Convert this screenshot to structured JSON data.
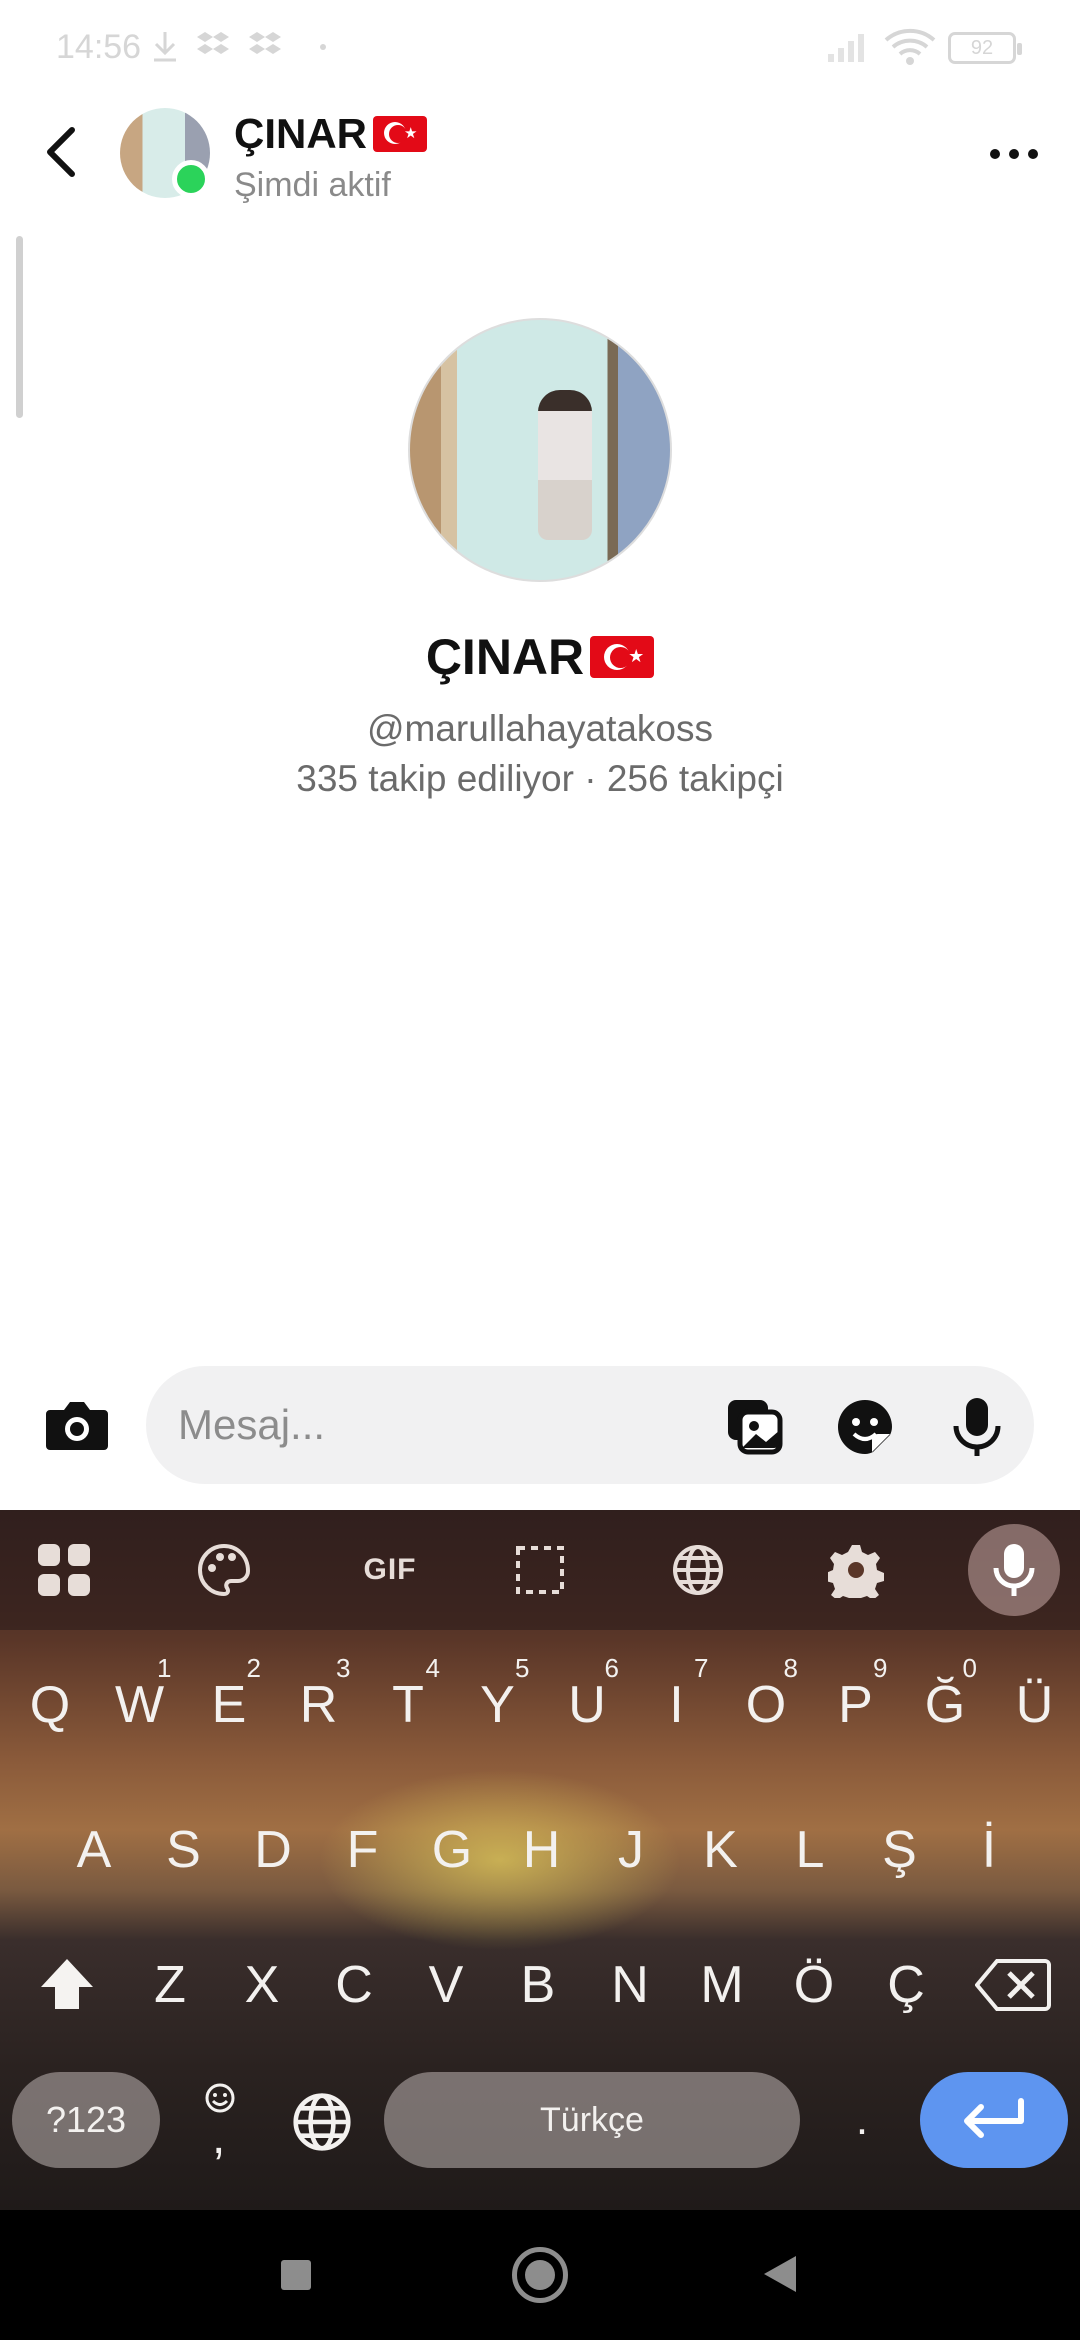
{
  "status_bar": {
    "time": "14:56",
    "battery": "92"
  },
  "header": {
    "name": "ÇINAR",
    "status": "Şimdi aktif"
  },
  "profile": {
    "name": "ÇINAR",
    "handle": "@marullahayatakoss",
    "stats": "335 takip ediliyor · 256 takipçi"
  },
  "composer": {
    "placeholder": "Mesaj..."
  },
  "keyboard": {
    "toolbar": {
      "gif_label": "GIF"
    },
    "row1": [
      {
        "k": "Q",
        "h": ""
      },
      {
        "k": "W",
        "h": "1"
      },
      {
        "k": "E",
        "h": "2"
      },
      {
        "k": "R",
        "h": "3"
      },
      {
        "k": "T",
        "h": "4"
      },
      {
        "k": "Y",
        "h": "5"
      },
      {
        "k": "U",
        "h": "6"
      },
      {
        "k": "I",
        "h": "7"
      },
      {
        "k": "O",
        "h": "8"
      },
      {
        "k": "P",
        "h": "9"
      },
      {
        "k": "Ğ",
        "h": "0"
      },
      {
        "k": "Ü",
        "h": ""
      }
    ],
    "row2": [
      "A",
      "S",
      "D",
      "F",
      "G",
      "H",
      "J",
      "K",
      "L",
      "Ş",
      "İ"
    ],
    "row3": [
      "Z",
      "X",
      "C",
      "V",
      "B",
      "N",
      "M",
      "Ö",
      "Ç"
    ],
    "symbols_label": "?123",
    "emoji_label": ",",
    "space_label": "Türkçe",
    "period_label": "."
  },
  "colors": {
    "online": "#2bd35a",
    "enter_key": "#5e95f0",
    "flag": "#e30a17"
  }
}
